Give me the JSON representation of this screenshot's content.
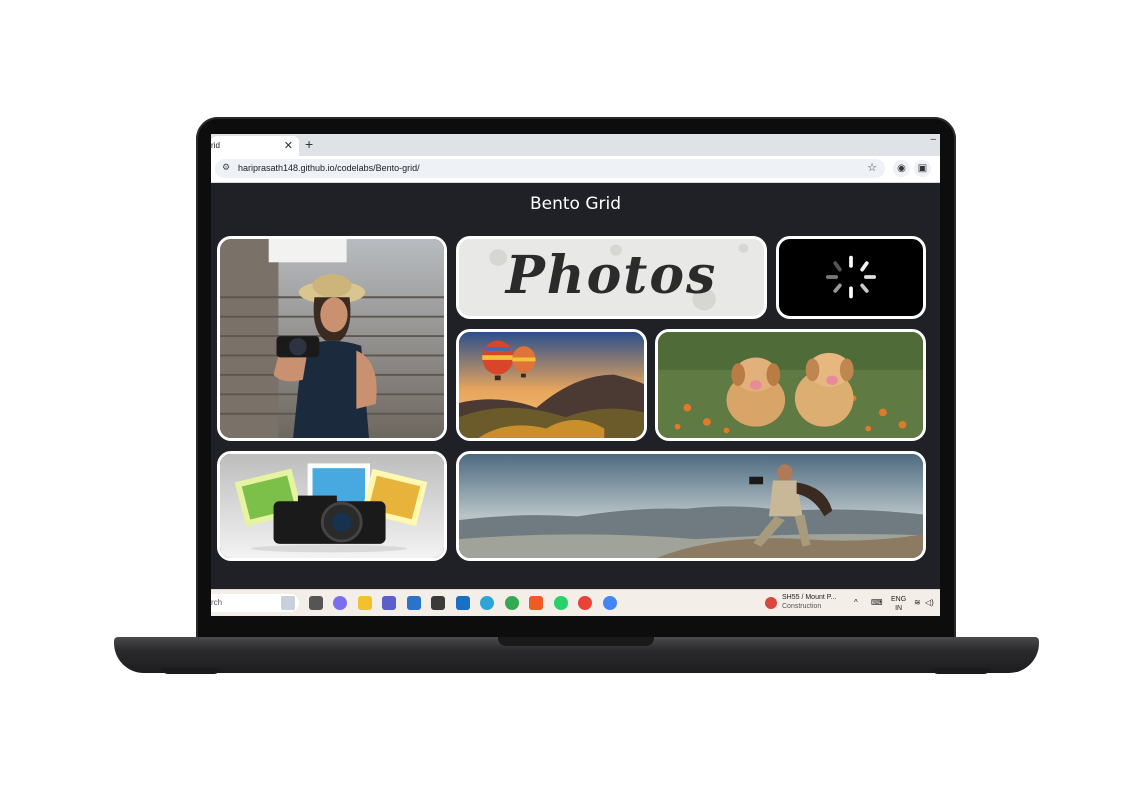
{
  "browser": {
    "tab_title": "rid",
    "tab_close": "✕",
    "new_tab": "+",
    "minimize": "–",
    "url": "hariprasath148.github.io/codelabs/Bento-grid/",
    "bookmark_icon": "☆",
    "camera_icon": "📷",
    "extensions_icon": "⧉"
  },
  "page": {
    "title": "Bento Grid",
    "photos_word": "Photos"
  },
  "taskbar": {
    "search_placeholder": "rch",
    "weather_title": "SH55 / Mount P...",
    "weather_sub": "Construction",
    "chevron": "^",
    "lang_1": "ENG",
    "lang_2": "IN",
    "wifi": "≋",
    "volume": "◁)"
  },
  "colors": {
    "page_bg": "#1f2127",
    "card_border": "#ffffff"
  }
}
